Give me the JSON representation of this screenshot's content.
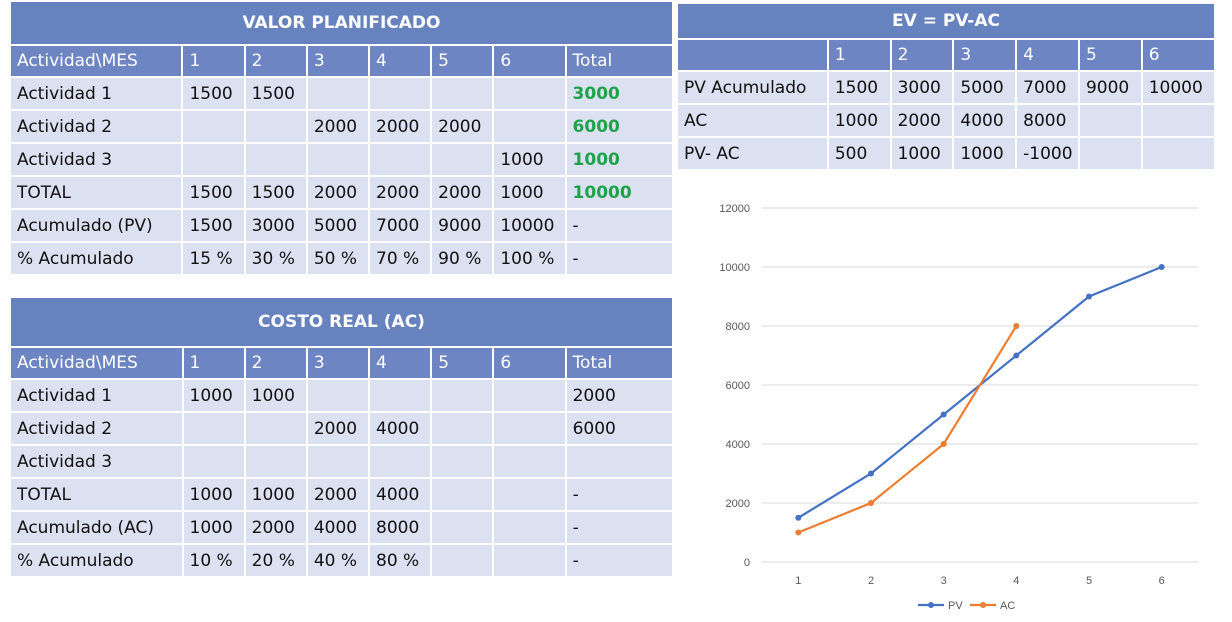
{
  "pv_table": {
    "title": "VALOR PLANIFICADO",
    "header": [
      "Actividad\\MES",
      "1",
      "2",
      "3",
      "4",
      "5",
      "6",
      "Total"
    ],
    "rows": [
      [
        "Actividad 1",
        "1500",
        "1500",
        "",
        "",
        "",
        "",
        "3000"
      ],
      [
        "Actividad 2",
        "",
        "",
        "2000",
        "2000",
        "2000",
        "",
        "6000"
      ],
      [
        "Actividad 3",
        "",
        "",
        "",
        "",
        "",
        "1000",
        "1000"
      ],
      [
        "TOTAL",
        "1500",
        "1500",
        "2000",
        "2000",
        "2000",
        "1000",
        "10000"
      ],
      [
        "Acumulado (PV)",
        "1500",
        "3000",
        "5000",
        "7000",
        "9000",
        "10000",
        "-"
      ],
      [
        "% Acumulado",
        "15 %",
        "30 %",
        "50 %",
        "70 %",
        "90 %",
        "100 %",
        "-"
      ]
    ],
    "total_color": "#1fa34a"
  },
  "ac_table": {
    "title": "COSTO REAL (AC)",
    "header": [
      "Actividad\\MES",
      "1",
      "2",
      "3",
      "4",
      "5",
      "6",
      "Total"
    ],
    "rows": [
      [
        "Actividad 1",
        "1000",
        "1000",
        "",
        "",
        "",
        "",
        "2000"
      ],
      [
        "Actividad 2",
        "",
        "",
        "2000",
        "4000",
        "",
        "",
        "6000"
      ],
      [
        "Actividad 3",
        "",
        "",
        "",
        "",
        "",
        "",
        ""
      ],
      [
        "TOTAL",
        "1000",
        "1000",
        "2000",
        "4000",
        "",
        "",
        "-"
      ],
      [
        "Acumulado (AC)",
        "1000",
        "2000",
        "4000",
        "8000",
        "",
        "",
        "-"
      ],
      [
        "% Acumulado",
        "10 %",
        "20 %",
        "40 %",
        "80 %",
        "",
        "",
        "-"
      ]
    ]
  },
  "ev_table": {
    "title": "EV = PV-AC",
    "header": [
      "",
      "1",
      "2",
      "3",
      "4",
      "5",
      "6"
    ],
    "rows": [
      [
        "PV Acumulado",
        "1500",
        "3000",
        "5000",
        "7000",
        "9000",
        "10000"
      ],
      [
        "AC",
        "1000",
        "2000",
        "4000",
        "8000",
        "",
        ""
      ],
      [
        "PV- AC",
        "500",
        "1000",
        "1000",
        "-1000",
        "",
        ""
      ]
    ]
  },
  "chart_data": {
    "type": "line",
    "x": [
      1,
      2,
      3,
      4,
      5,
      6
    ],
    "categories": [
      "1",
      "2",
      "3",
      "4",
      "5",
      "6"
    ],
    "series": [
      {
        "name": "PV",
        "values": [
          1500,
          3000,
          5000,
          7000,
          9000,
          10000
        ],
        "color": "#4472c4"
      },
      {
        "name": "AC",
        "values": [
          1000,
          2000,
          4000,
          8000,
          null,
          null
        ],
        "color": "#ed7d31"
      }
    ],
    "y_ticks": [
      0,
      2000,
      4000,
      6000,
      8000,
      10000,
      12000
    ],
    "ylim": [
      0,
      12000
    ],
    "grid": true,
    "legend_position": "bottom"
  }
}
